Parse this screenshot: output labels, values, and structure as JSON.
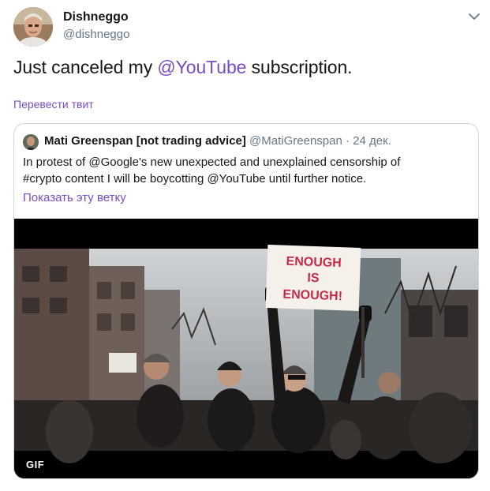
{
  "author": {
    "name": "Dishneggo",
    "handle": "@dishneggo"
  },
  "tweet": {
    "text_before": "Just canceled my ",
    "mention": "@YouTube",
    "text_after": " subscription."
  },
  "translate_label": "Перевести твит",
  "quoted": {
    "name": "Mati Greenspan [not trading advice]",
    "handle": "@MatiGreenspan",
    "separator": "·",
    "date": "24 дек.",
    "text_line1": "In protest of @Google's new unexpected and unexplained censorship of",
    "text_line2": "#crypto content I will be boycotting @YouTube until further notice.",
    "show_thread": "Показать эту ветку",
    "media": {
      "badge": "GIF",
      "sign_line1": "ENOUGH",
      "sign_line2": "IS",
      "sign_line3": "ENOUGH!"
    }
  },
  "colors": {
    "accent": "#794bc4",
    "secondary_text": "#657786",
    "border": "#ccd6dd"
  },
  "icons": {
    "menu": "chevron-down-icon"
  }
}
